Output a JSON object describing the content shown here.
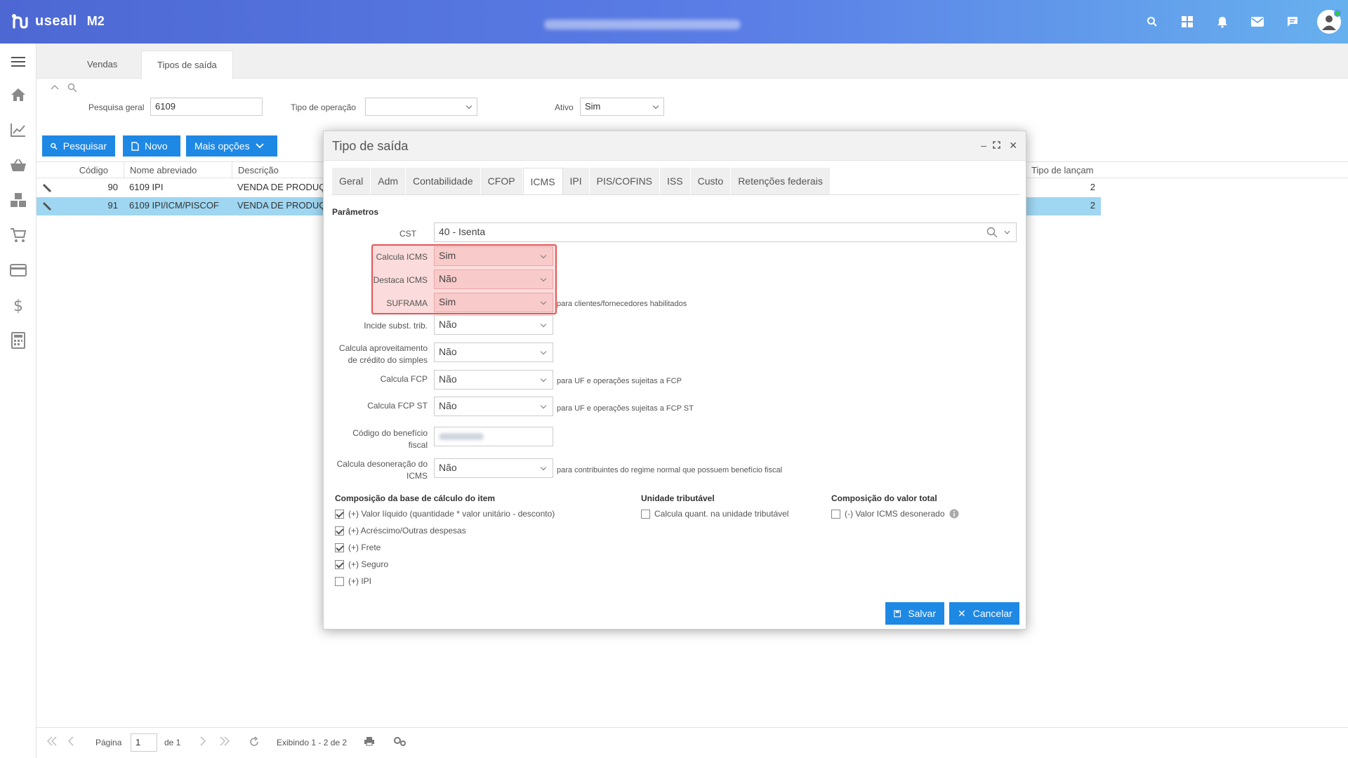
{
  "app": {
    "brand": "useall",
    "version": "M2"
  },
  "topbar": {
    "icons": [
      "search-icon",
      "grid-icon",
      "bell-icon",
      "mail-icon",
      "chat-icon",
      "avatar"
    ]
  },
  "sidebar": {
    "icons": [
      "menu-icon",
      "home-icon",
      "chart-icon",
      "basket-icon",
      "boxes-icon",
      "cart-icon",
      "card-icon",
      "dollar-icon",
      "calculator-icon"
    ]
  },
  "page_tabs": [
    {
      "label": "Vendas"
    },
    {
      "label": "Tipos de saída"
    }
  ],
  "filters": {
    "search_label": "Pesquisa geral",
    "search_value": "6109",
    "op_label": "Tipo de operação",
    "op_value": "",
    "active_label": "Ativo",
    "active_value": "Sim"
  },
  "actions": {
    "search": "Pesquisar",
    "new": "Novo",
    "more": "Mais opções"
  },
  "grid": {
    "headers": {
      "code": "Código",
      "short_name": "Nome abreviado",
      "description": "Descrição",
      "launch_type": "Tipo de lançam"
    },
    "rows": [
      {
        "code": "90",
        "short_name": "6109 IPI",
        "description": "VENDA DE PRODUÇ",
        "launch_type": "2"
      },
      {
        "code": "91",
        "short_name": "6109 IPI/ICM/PISCOF",
        "description": "VENDA DE PRODUÇ",
        "launch_type": "2"
      }
    ]
  },
  "pager": {
    "page_label": "Página",
    "page_value": "1",
    "of_label": "de 1",
    "showing": "Exibindo 1 - 2 de 2"
  },
  "modal": {
    "title": "Tipo de saída",
    "tabs": [
      "Geral",
      "Adm",
      "Contabilidade",
      "CFOP",
      "ICMS",
      "IPI",
      "PIS/COFINS",
      "ISS",
      "Custo",
      "Retenções federais"
    ],
    "active_tab": "ICMS",
    "section": "Parâmetros",
    "cst": {
      "label": "CST",
      "value": "40 - Isenta"
    },
    "calcula_icms": {
      "label": "Calcula ICMS",
      "value": "Sim"
    },
    "destaca_icms": {
      "label": "Destaca ICMS",
      "value": "Não"
    },
    "suframa": {
      "label": "SUFRAMA",
      "value": "Sim",
      "hint": "para clientes/fornecedores habilitados"
    },
    "incide_subst": {
      "label": "Incide subst. trib.",
      "value": "Não"
    },
    "aproveitamento": {
      "label_1": "Calcula aproveitamento",
      "label_2": "de crédito do simples",
      "value": "Não"
    },
    "fcp": {
      "label": "Calcula FCP",
      "value": "Não",
      "hint": "para UF e operações sujeitas a FCP"
    },
    "fcp_st": {
      "label": "Calcula FCP ST",
      "value": "Não",
      "hint": "para UF e operações sujeitas a FCP ST"
    },
    "beneficio": {
      "label_1": "Código do benefício",
      "label_2": "fiscal",
      "value": ""
    },
    "desoneracao": {
      "label_1": "Calcula desoneração do",
      "label_2": "ICMS",
      "value": "Não",
      "hint": "para contribuintes do regime normal que possuem benefício fiscal"
    },
    "base_title": "Composição da base de cálculo do item",
    "base_items": [
      {
        "label": "(+) Valor líquido (quantidade * valor unitário - desconto)",
        "checked": true
      },
      {
        "label": "(+) Acréscimo/Outras despesas",
        "checked": true
      },
      {
        "label": "(+) Frete",
        "checked": true
      },
      {
        "label": "(+) Seguro",
        "checked": true
      },
      {
        "label": "(+) IPI",
        "checked": false
      }
    ],
    "unidade_title": "Unidade tributável",
    "unidade_item": {
      "label": "Calcula quant. na unidade tributável",
      "checked": false
    },
    "total_title": "Composição do valor total",
    "total_item": {
      "label": "(-) Valor ICMS desonerado",
      "checked": false
    },
    "save": "Salvar",
    "cancel": "Cancelar"
  },
  "colors": {
    "accent": "#1e88e5",
    "selected_row": "#9fd6f2",
    "highlight": "#e35656"
  }
}
